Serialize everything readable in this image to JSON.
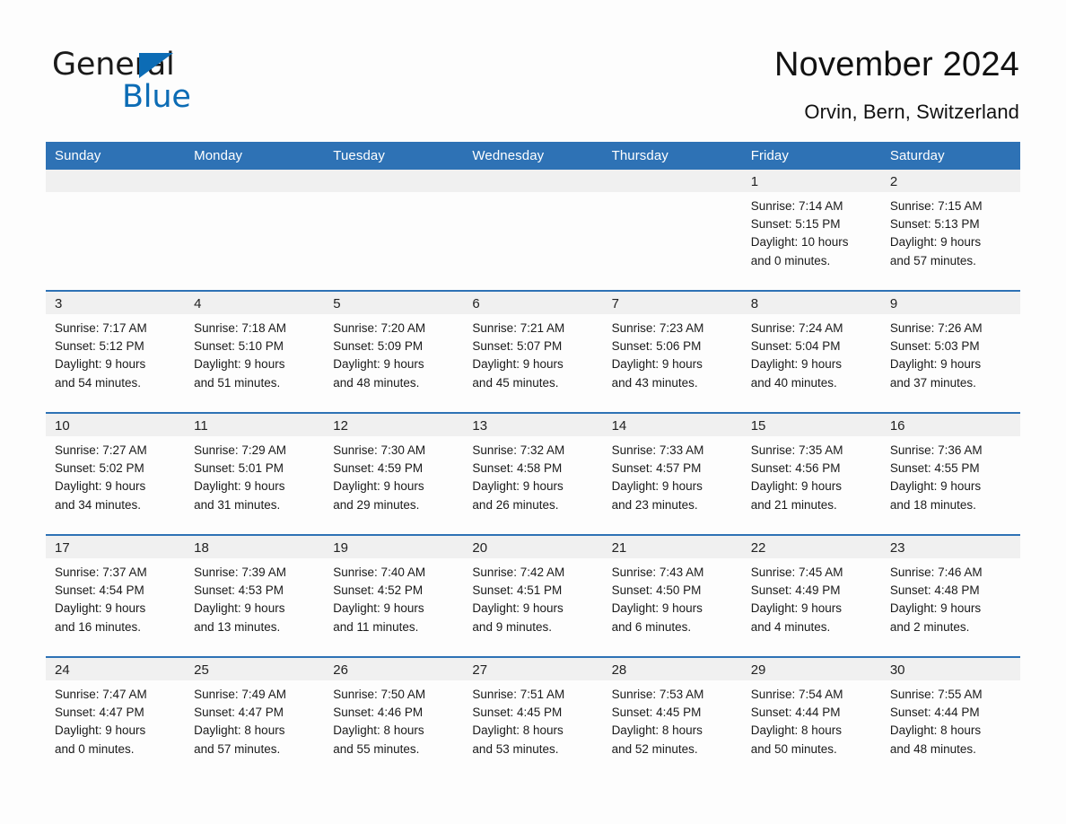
{
  "brand": {
    "word_one": "General",
    "word_two": "Blue",
    "accent_color": "#0c6cb5",
    "triangle_icon": "brand-triangle-icon"
  },
  "header": {
    "title": "November 2024",
    "location": "Orvin, Bern, Switzerland"
  },
  "theme": {
    "header_blue": "#2e72b5",
    "daynum_band": "#f0f0f0",
    "page_background": "#fdfdfd",
    "text_color": "#1a1a1a"
  },
  "calendar": {
    "weekday_headers": [
      "Sunday",
      "Monday",
      "Tuesday",
      "Wednesday",
      "Thursday",
      "Friday",
      "Saturday"
    ],
    "labels": {
      "sunrise_prefix": "Sunrise:",
      "sunset_prefix": "Sunset:",
      "daylight_prefix": "Daylight:"
    },
    "weeks": [
      [
        {
          "day": "",
          "empty": true
        },
        {
          "day": "",
          "empty": true
        },
        {
          "day": "",
          "empty": true
        },
        {
          "day": "",
          "empty": true
        },
        {
          "day": "",
          "empty": true
        },
        {
          "day": "1",
          "sunrise": "Sunrise: 7:14 AM",
          "sunset": "Sunset: 5:15 PM",
          "daylight_line1": "Daylight: 10 hours",
          "daylight_line2": "and 0 minutes."
        },
        {
          "day": "2",
          "sunrise": "Sunrise: 7:15 AM",
          "sunset": "Sunset: 5:13 PM",
          "daylight_line1": "Daylight: 9 hours",
          "daylight_line2": "and 57 minutes."
        }
      ],
      [
        {
          "day": "3",
          "sunrise": "Sunrise: 7:17 AM",
          "sunset": "Sunset: 5:12 PM",
          "daylight_line1": "Daylight: 9 hours",
          "daylight_line2": "and 54 minutes."
        },
        {
          "day": "4",
          "sunrise": "Sunrise: 7:18 AM",
          "sunset": "Sunset: 5:10 PM",
          "daylight_line1": "Daylight: 9 hours",
          "daylight_line2": "and 51 minutes."
        },
        {
          "day": "5",
          "sunrise": "Sunrise: 7:20 AM",
          "sunset": "Sunset: 5:09 PM",
          "daylight_line1": "Daylight: 9 hours",
          "daylight_line2": "and 48 minutes."
        },
        {
          "day": "6",
          "sunrise": "Sunrise: 7:21 AM",
          "sunset": "Sunset: 5:07 PM",
          "daylight_line1": "Daylight: 9 hours",
          "daylight_line2": "and 45 minutes."
        },
        {
          "day": "7",
          "sunrise": "Sunrise: 7:23 AM",
          "sunset": "Sunset: 5:06 PM",
          "daylight_line1": "Daylight: 9 hours",
          "daylight_line2": "and 43 minutes."
        },
        {
          "day": "8",
          "sunrise": "Sunrise: 7:24 AM",
          "sunset": "Sunset: 5:04 PM",
          "daylight_line1": "Daylight: 9 hours",
          "daylight_line2": "and 40 minutes."
        },
        {
          "day": "9",
          "sunrise": "Sunrise: 7:26 AM",
          "sunset": "Sunset: 5:03 PM",
          "daylight_line1": "Daylight: 9 hours",
          "daylight_line2": "and 37 minutes."
        }
      ],
      [
        {
          "day": "10",
          "sunrise": "Sunrise: 7:27 AM",
          "sunset": "Sunset: 5:02 PM",
          "daylight_line1": "Daylight: 9 hours",
          "daylight_line2": "and 34 minutes."
        },
        {
          "day": "11",
          "sunrise": "Sunrise: 7:29 AM",
          "sunset": "Sunset: 5:01 PM",
          "daylight_line1": "Daylight: 9 hours",
          "daylight_line2": "and 31 minutes."
        },
        {
          "day": "12",
          "sunrise": "Sunrise: 7:30 AM",
          "sunset": "Sunset: 4:59 PM",
          "daylight_line1": "Daylight: 9 hours",
          "daylight_line2": "and 29 minutes."
        },
        {
          "day": "13",
          "sunrise": "Sunrise: 7:32 AM",
          "sunset": "Sunset: 4:58 PM",
          "daylight_line1": "Daylight: 9 hours",
          "daylight_line2": "and 26 minutes."
        },
        {
          "day": "14",
          "sunrise": "Sunrise: 7:33 AM",
          "sunset": "Sunset: 4:57 PM",
          "daylight_line1": "Daylight: 9 hours",
          "daylight_line2": "and 23 minutes."
        },
        {
          "day": "15",
          "sunrise": "Sunrise: 7:35 AM",
          "sunset": "Sunset: 4:56 PM",
          "daylight_line1": "Daylight: 9 hours",
          "daylight_line2": "and 21 minutes."
        },
        {
          "day": "16",
          "sunrise": "Sunrise: 7:36 AM",
          "sunset": "Sunset: 4:55 PM",
          "daylight_line1": "Daylight: 9 hours",
          "daylight_line2": "and 18 minutes."
        }
      ],
      [
        {
          "day": "17",
          "sunrise": "Sunrise: 7:37 AM",
          "sunset": "Sunset: 4:54 PM",
          "daylight_line1": "Daylight: 9 hours",
          "daylight_line2": "and 16 minutes."
        },
        {
          "day": "18",
          "sunrise": "Sunrise: 7:39 AM",
          "sunset": "Sunset: 4:53 PM",
          "daylight_line1": "Daylight: 9 hours",
          "daylight_line2": "and 13 minutes."
        },
        {
          "day": "19",
          "sunrise": "Sunrise: 7:40 AM",
          "sunset": "Sunset: 4:52 PM",
          "daylight_line1": "Daylight: 9 hours",
          "daylight_line2": "and 11 minutes."
        },
        {
          "day": "20",
          "sunrise": "Sunrise: 7:42 AM",
          "sunset": "Sunset: 4:51 PM",
          "daylight_line1": "Daylight: 9 hours",
          "daylight_line2": "and 9 minutes."
        },
        {
          "day": "21",
          "sunrise": "Sunrise: 7:43 AM",
          "sunset": "Sunset: 4:50 PM",
          "daylight_line1": "Daylight: 9 hours",
          "daylight_line2": "and 6 minutes."
        },
        {
          "day": "22",
          "sunrise": "Sunrise: 7:45 AM",
          "sunset": "Sunset: 4:49 PM",
          "daylight_line1": "Daylight: 9 hours",
          "daylight_line2": "and 4 minutes."
        },
        {
          "day": "23",
          "sunrise": "Sunrise: 7:46 AM",
          "sunset": "Sunset: 4:48 PM",
          "daylight_line1": "Daylight: 9 hours",
          "daylight_line2": "and 2 minutes."
        }
      ],
      [
        {
          "day": "24",
          "sunrise": "Sunrise: 7:47 AM",
          "sunset": "Sunset: 4:47 PM",
          "daylight_line1": "Daylight: 9 hours",
          "daylight_line2": "and 0 minutes."
        },
        {
          "day": "25",
          "sunrise": "Sunrise: 7:49 AM",
          "sunset": "Sunset: 4:47 PM",
          "daylight_line1": "Daylight: 8 hours",
          "daylight_line2": "and 57 minutes."
        },
        {
          "day": "26",
          "sunrise": "Sunrise: 7:50 AM",
          "sunset": "Sunset: 4:46 PM",
          "daylight_line1": "Daylight: 8 hours",
          "daylight_line2": "and 55 minutes."
        },
        {
          "day": "27",
          "sunrise": "Sunrise: 7:51 AM",
          "sunset": "Sunset: 4:45 PM",
          "daylight_line1": "Daylight: 8 hours",
          "daylight_line2": "and 53 minutes."
        },
        {
          "day": "28",
          "sunrise": "Sunrise: 7:53 AM",
          "sunset": "Sunset: 4:45 PM",
          "daylight_line1": "Daylight: 8 hours",
          "daylight_line2": "and 52 minutes."
        },
        {
          "day": "29",
          "sunrise": "Sunrise: 7:54 AM",
          "sunset": "Sunset: 4:44 PM",
          "daylight_line1": "Daylight: 8 hours",
          "daylight_line2": "and 50 minutes."
        },
        {
          "day": "30",
          "sunrise": "Sunrise: 7:55 AM",
          "sunset": "Sunset: 4:44 PM",
          "daylight_line1": "Daylight: 8 hours",
          "daylight_line2": "and 48 minutes."
        }
      ]
    ]
  }
}
